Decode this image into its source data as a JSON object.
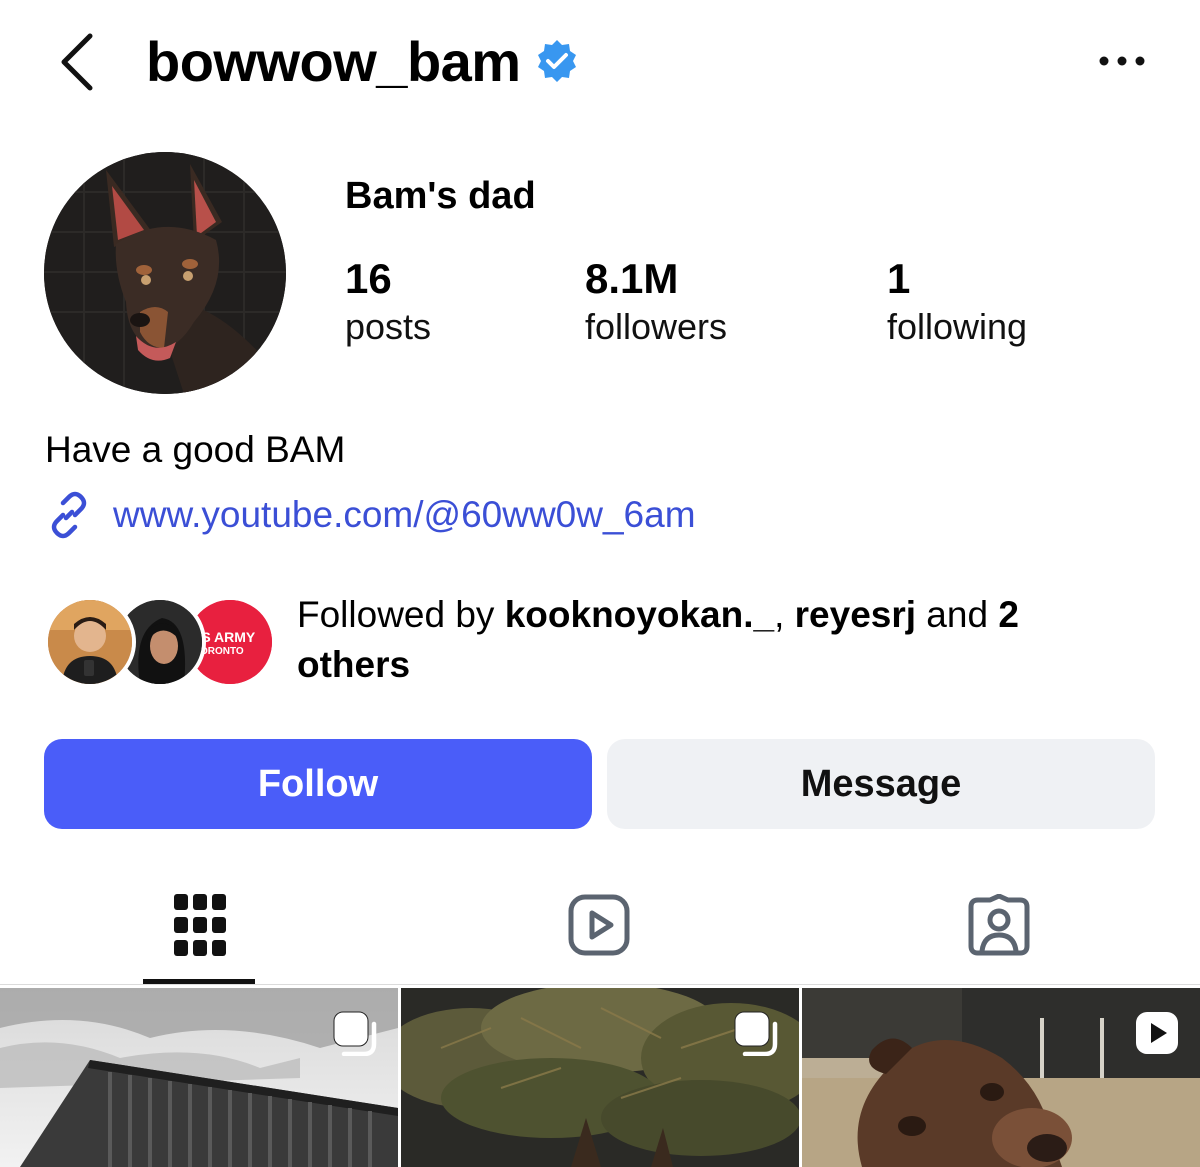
{
  "header": {
    "username": "bowwow_bam",
    "back_icon": "chevron-left-icon",
    "verified_icon": "verified-badge-icon",
    "more_icon": "more-horizontal-icon"
  },
  "profile": {
    "display_name": "Bam's dad",
    "stats": [
      {
        "value": "16",
        "label": "posts"
      },
      {
        "value": "8.1M",
        "label": "followers"
      },
      {
        "value": "1",
        "label": "following"
      }
    ],
    "bio": "Have a good BAM",
    "link": "www.youtube.com/@60ww0w_6am"
  },
  "followed_by": {
    "prefix": "Followed by ",
    "user1": "kooknoyokan._",
    "separator": ", ",
    "user2": "reyesrj",
    "middle": " and ",
    "count_text": "2 others",
    "avatar3_line1": "'S ARMY",
    "avatar3_line2": "ORONTO"
  },
  "actions": {
    "follow_label": "Follow",
    "message_label": "Message"
  },
  "tabs": [
    {
      "icon": "grid-icon",
      "selected": true
    },
    {
      "icon": "reels-icon",
      "selected": false
    },
    {
      "icon": "tagged-icon",
      "selected": false
    }
  ],
  "posts": [
    {
      "type": "carousel",
      "badge_icon": "carousel-icon"
    },
    {
      "type": "carousel",
      "badge_icon": "carousel-icon"
    },
    {
      "type": "reel",
      "badge_icon": "reel-play-icon"
    }
  ],
  "colors": {
    "follow_button": "#4a5df9",
    "message_button": "#eff1f4",
    "verified": "#3897f0",
    "link": "#3b4fd6"
  }
}
